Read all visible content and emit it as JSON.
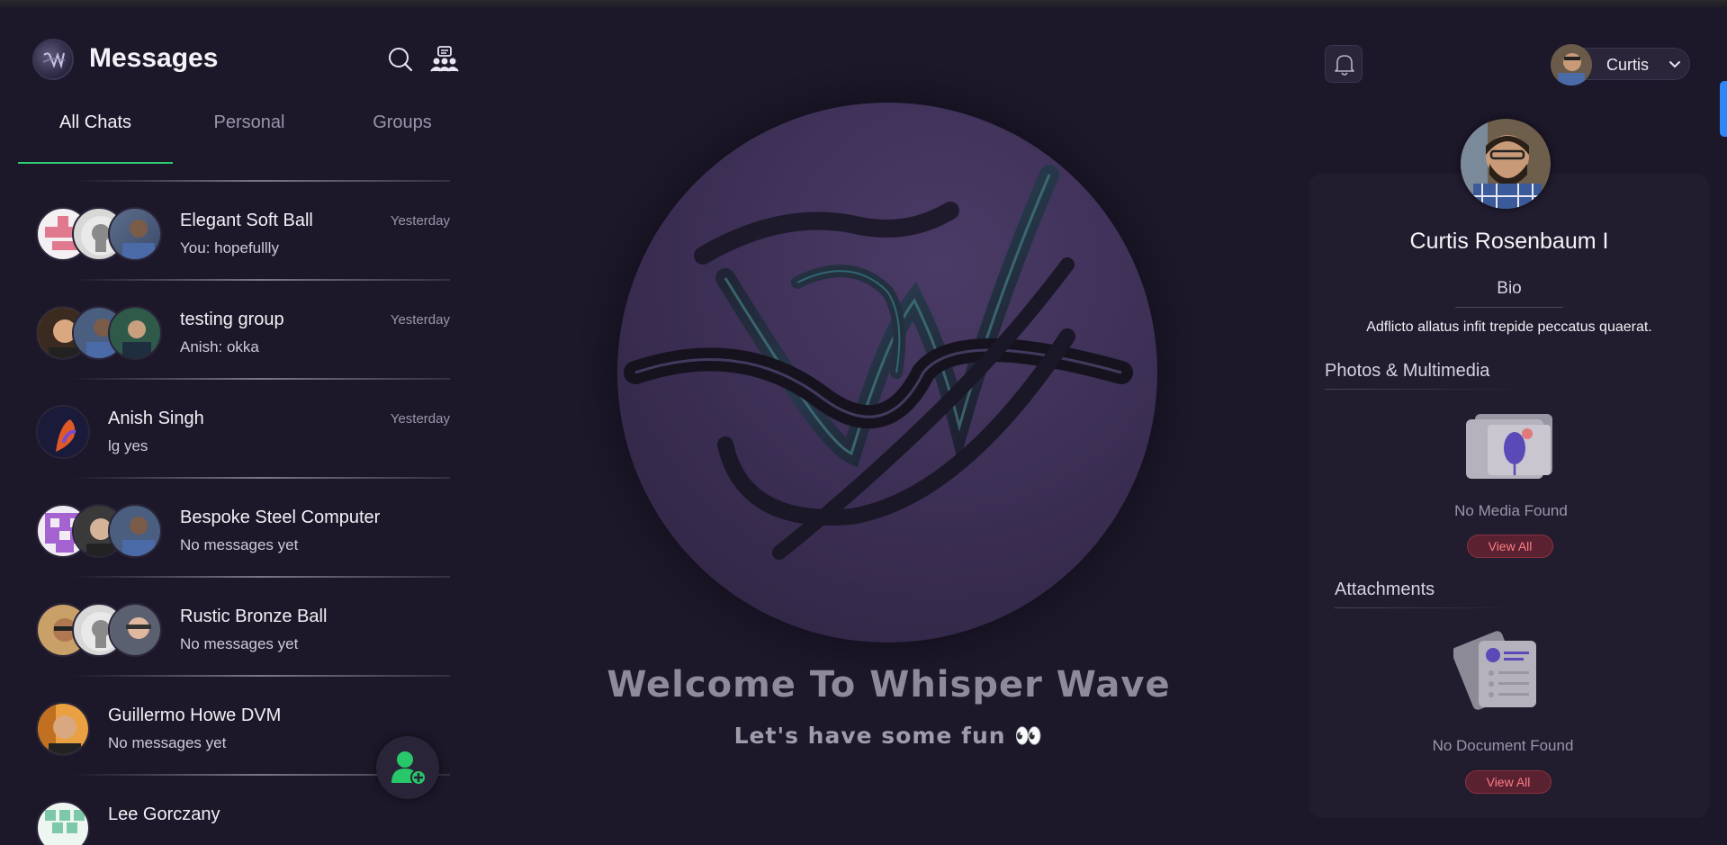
{
  "header": {
    "title": "Messages"
  },
  "tabs": [
    {
      "label": "All Chats",
      "active": true
    },
    {
      "label": "Personal",
      "active": false
    },
    {
      "label": "Groups",
      "active": false
    }
  ],
  "chats": [
    {
      "name": "Elegant Soft Ball",
      "last_message": "You: hopefullly",
      "time": "Yesterday"
    },
    {
      "name": "testing group",
      "last_message": "Anish: okka",
      "time": "Yesterday"
    },
    {
      "name": "Anish Singh",
      "last_message": "lg yes",
      "time": "Yesterday"
    },
    {
      "name": "Bespoke Steel Computer",
      "last_message": "No messages yet",
      "time": ""
    },
    {
      "name": "Rustic Bronze Ball",
      "last_message": "No messages yet",
      "time": ""
    },
    {
      "name": "Guillermo Howe DVM",
      "last_message": "No messages yet",
      "time": ""
    },
    {
      "name": "Lee Gorczany",
      "last_message": "",
      "time": ""
    }
  ],
  "center": {
    "welcome": "Welcome To Whisper Wave",
    "subtitle": "Let's have some fun 👀"
  },
  "topbar": {
    "user_name": "Curtis"
  },
  "profile": {
    "name": "Curtis Rosenbaum I",
    "bio_label": "Bio",
    "bio": "Adflicto allatus infit trepide peccatus quaerat.",
    "media_title": "Photos & Multimedia",
    "media_empty": "No Media Found",
    "attachments_title": "Attachments",
    "attachments_empty": "No Document Found",
    "view_all": "View All"
  },
  "colors": {
    "accent_green": "#2ecc71",
    "background": "#1c1729",
    "view_all_red": "#ff7a85",
    "scroll_blue": "#2f86f6"
  }
}
